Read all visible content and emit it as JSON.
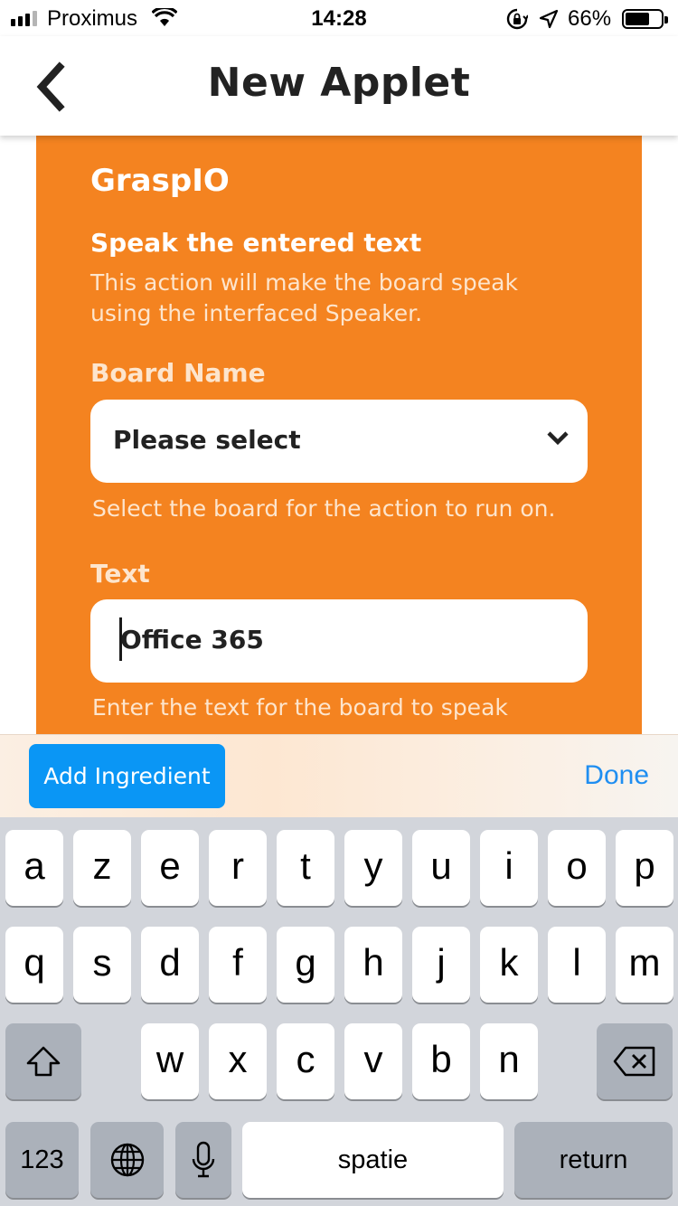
{
  "status_bar": {
    "carrier": "Proximus",
    "time": "14:28",
    "battery": "66%"
  },
  "nav": {
    "title": "New Applet",
    "back_icon": "chevron-left-icon"
  },
  "card": {
    "background": "#f48320",
    "service_name": "GraspIO",
    "action_title": "Speak the entered text",
    "action_description": "This action will make the board speak using the interfaced Speaker.",
    "fields": {
      "board_name": {
        "label": "Board Name",
        "value": "Please select",
        "helper": "Select the board for the action to run on."
      },
      "text": {
        "label": "Text",
        "value": "Office 365",
        "helper": "Enter the text for the board to speak"
      }
    }
  },
  "accessory_bar": {
    "add_ingredient_label": "Add Ingredient",
    "done_label": "Done",
    "accent": "#0a96f5"
  },
  "keyboard": {
    "row1": [
      "a",
      "z",
      "e",
      "r",
      "t",
      "y",
      "u",
      "i",
      "o",
      "p"
    ],
    "row2": [
      "q",
      "s",
      "d",
      "f",
      "g",
      "h",
      "j",
      "k",
      "l",
      "m"
    ],
    "row3": [
      "w",
      "x",
      "c",
      "v",
      "b",
      "n"
    ],
    "numbers_label": "123",
    "space_label": "spatie",
    "return_label": "return",
    "shift_icon": "shift-icon",
    "backspace_icon": "backspace-icon",
    "globe_icon": "globe-icon",
    "mic_icon": "microphone-icon"
  }
}
